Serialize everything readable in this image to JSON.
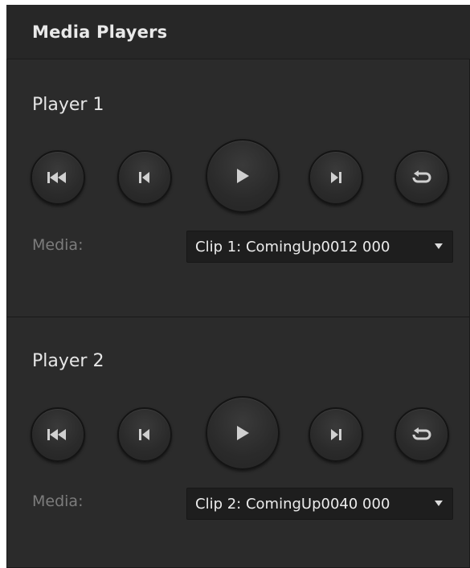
{
  "panel": {
    "title": "Media Players"
  },
  "players": [
    {
      "title": "Player 1",
      "media_label": "Media:",
      "media_value": "Clip 1: ComingUp0012 000"
    },
    {
      "title": "Player 2",
      "media_label": "Media:",
      "media_value": "Clip 2: ComingUp0040 000"
    }
  ],
  "icons": {
    "rewind": "rewind-to-start-icon",
    "prev": "previous-frame-icon",
    "play": "play-icon",
    "next": "next-frame-icon",
    "loop": "loop-icon"
  },
  "colors": {
    "panel_bg": "#2b2b2b",
    "header_bg": "#272727",
    "button_icon": "#d0d0d0",
    "label_text": "#7c7c7c",
    "select_bg": "#1e1e1e"
  }
}
